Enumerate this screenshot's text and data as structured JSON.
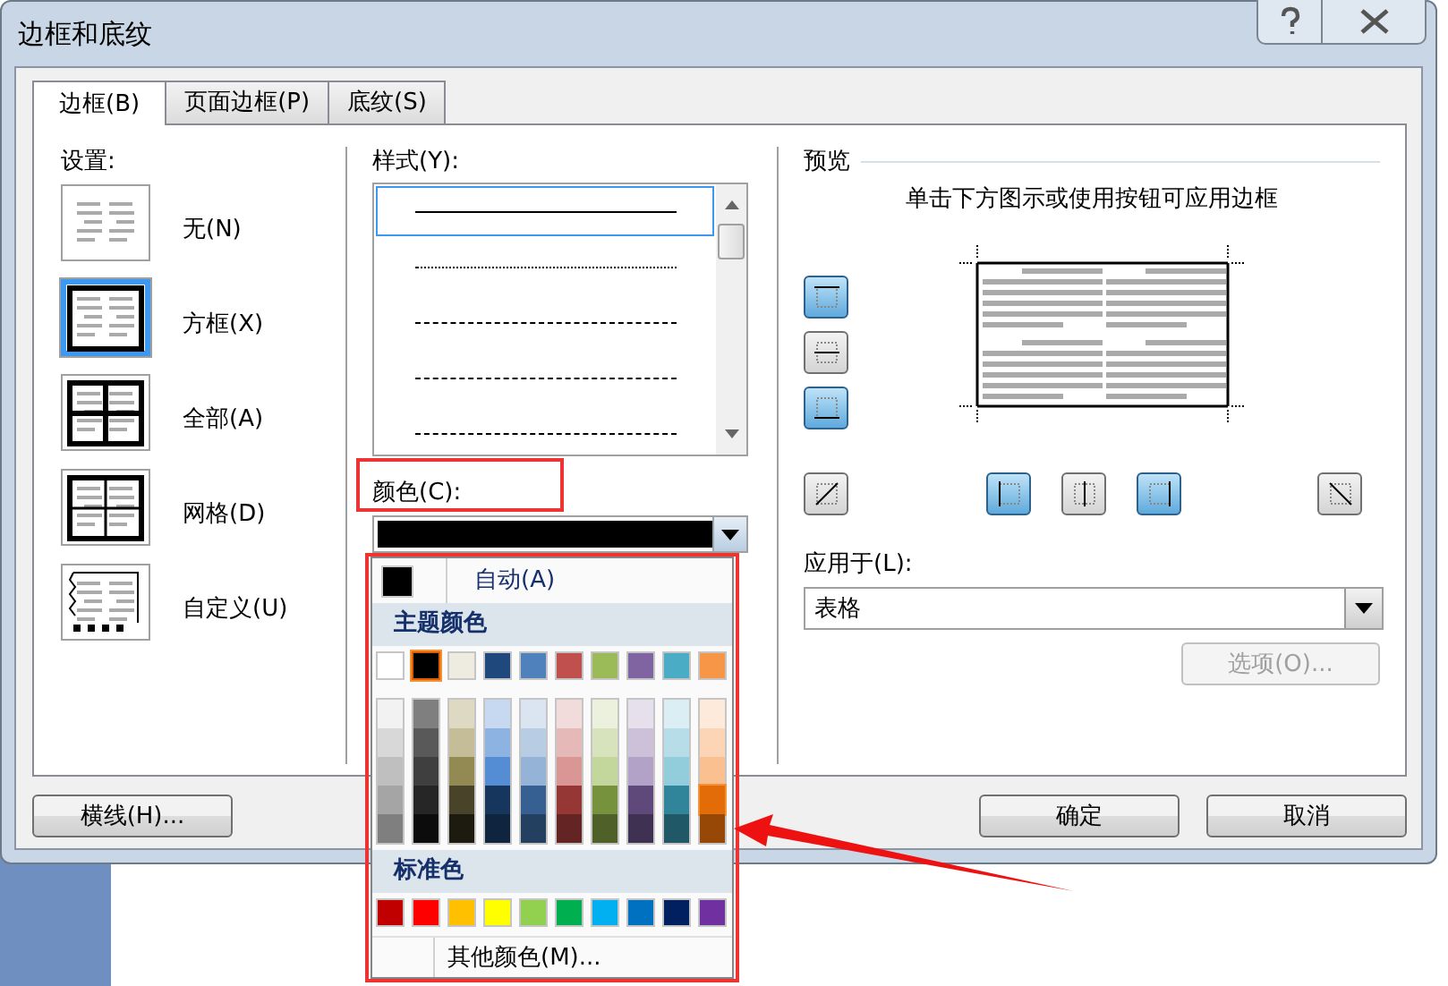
{
  "window": {
    "title": "边框和底纹"
  },
  "tabs": [
    {
      "label": "边框(B)",
      "selected": true
    },
    {
      "label": "页面边框(P)",
      "selected": false
    },
    {
      "label": "底纹(S)",
      "selected": false
    }
  ],
  "settings": {
    "label": "设置:",
    "items": [
      {
        "kind": "none",
        "label": "无(N)",
        "selected": false
      },
      {
        "kind": "box",
        "label": "方框(X)",
        "selected": true
      },
      {
        "kind": "all",
        "label": "全部(A)",
        "selected": false
      },
      {
        "kind": "grid",
        "label": "网格(D)",
        "selected": false
      },
      {
        "kind": "custom",
        "label": "自定义(U)",
        "selected": false
      }
    ]
  },
  "style": {
    "label": "样式(Y):",
    "lines": [
      {
        "kind": "solid",
        "selected": true
      },
      {
        "kind": "dotted",
        "selected": false
      },
      {
        "kind": "dashed",
        "selected": false
      },
      {
        "kind": "long-dash",
        "selected": false
      },
      {
        "kind": "dash-dot",
        "selected": false
      }
    ]
  },
  "color": {
    "label": "颜色(C):",
    "color": "#000000"
  },
  "color_menu": {
    "automatic": {
      "label": "自动(A)",
      "color": "#000000"
    },
    "theme_heading": "主题颜色",
    "theme_colors": [
      {
        "color": "#ffffff",
        "selected": false
      },
      {
        "color": "#000000",
        "selected": true
      },
      {
        "color": "#eeece1",
        "selected": false
      },
      {
        "color": "#1f497d",
        "selected": false
      },
      {
        "color": "#4f81bd",
        "selected": false
      },
      {
        "color": "#c0504d",
        "selected": false
      },
      {
        "color": "#9bbb59",
        "selected": false
      },
      {
        "color": "#8064a2",
        "selected": false
      },
      {
        "color": "#4bacc6",
        "selected": false
      },
      {
        "color": "#f79646",
        "selected": false
      }
    ],
    "theme_shades": [
      [
        {
          "color": "#f2f2f2",
          "selected": false
        },
        {
          "color": "#d8d8d8",
          "selected": false
        },
        {
          "color": "#bfbfbf",
          "selected": false
        },
        {
          "color": "#a5a5a5",
          "selected": false
        },
        {
          "color": "#7f7f7f",
          "selected": false
        }
      ],
      [
        {
          "color": "#7f7f7f",
          "selected": false
        },
        {
          "color": "#595959",
          "selected": false
        },
        {
          "color": "#3f3f3f",
          "selected": false
        },
        {
          "color": "#262626",
          "selected": false
        },
        {
          "color": "#0c0c0c",
          "selected": false
        }
      ],
      [
        {
          "color": "#ddd9c3",
          "selected": false
        },
        {
          "color": "#c4bd97",
          "selected": false
        },
        {
          "color": "#938953",
          "selected": false
        },
        {
          "color": "#494429",
          "selected": false
        },
        {
          "color": "#1d1b10",
          "selected": false
        }
      ],
      [
        {
          "color": "#c6d9f0",
          "selected": false
        },
        {
          "color": "#8db3e2",
          "selected": false
        },
        {
          "color": "#548dd4",
          "selected": false
        },
        {
          "color": "#17365d",
          "selected": false
        },
        {
          "color": "#0f243e",
          "selected": false
        }
      ],
      [
        {
          "color": "#dbe5f1",
          "selected": false
        },
        {
          "color": "#b8cce4",
          "selected": false
        },
        {
          "color": "#95b3d7",
          "selected": false
        },
        {
          "color": "#366092",
          "selected": false
        },
        {
          "color": "#244061",
          "selected": false
        }
      ],
      [
        {
          "color": "#f2dcdb",
          "selected": false
        },
        {
          "color": "#e5b9b7",
          "selected": false
        },
        {
          "color": "#d99694",
          "selected": false
        },
        {
          "color": "#953734",
          "selected": false
        },
        {
          "color": "#632423",
          "selected": false
        }
      ],
      [
        {
          "color": "#ebf1dd",
          "selected": false
        },
        {
          "color": "#d7e3bc",
          "selected": false
        },
        {
          "color": "#c3d69b",
          "selected": false
        },
        {
          "color": "#76923c",
          "selected": false
        },
        {
          "color": "#4f6128",
          "selected": false
        }
      ],
      [
        {
          "color": "#e5e0ec",
          "selected": false
        },
        {
          "color": "#ccc1d9",
          "selected": false
        },
        {
          "color": "#b2a2c7",
          "selected": false
        },
        {
          "color": "#5f497a",
          "selected": false
        },
        {
          "color": "#3f3151",
          "selected": false
        }
      ],
      [
        {
          "color": "#dbeef3",
          "selected": false
        },
        {
          "color": "#b7dde8",
          "selected": false
        },
        {
          "color": "#92cddc",
          "selected": false
        },
        {
          "color": "#31859b",
          "selected": false
        },
        {
          "color": "#205867",
          "selected": false
        }
      ],
      [
        {
          "color": "#fdeada",
          "selected": false
        },
        {
          "color": "#fbd5b5",
          "selected": false
        },
        {
          "color": "#fac08f",
          "selected": false
        },
        {
          "color": "#e36c09",
          "selected": true
        },
        {
          "color": "#974806",
          "selected": false
        }
      ]
    ],
    "standard_heading": "标准色",
    "standard_colors": [
      {
        "color": "#c00000",
        "selected": false
      },
      {
        "color": "#ff0000",
        "selected": false
      },
      {
        "color": "#ffc000",
        "selected": false
      },
      {
        "color": "#ffff00",
        "selected": false
      },
      {
        "color": "#92d050",
        "selected": false
      },
      {
        "color": "#00b050",
        "selected": false
      },
      {
        "color": "#00b0f0",
        "selected": false
      },
      {
        "color": "#0070c0",
        "selected": false
      },
      {
        "color": "#002060",
        "selected": false
      },
      {
        "color": "#7030a0",
        "selected": false
      }
    ],
    "more_colors": "其他颜色(M)..."
  },
  "preview": {
    "label": "预览",
    "hint": "单击下方图示或使用按钮可应用边框",
    "side_buttons": [
      {
        "kind": "top",
        "on": true
      },
      {
        "kind": "middle",
        "on": false
      },
      {
        "kind": "bottom",
        "on": true
      }
    ],
    "bottom_buttons": [
      {
        "kind": "diagonal-up",
        "on": false
      },
      {
        "kind": "left",
        "on": true
      },
      {
        "kind": "center",
        "on": false
      },
      {
        "kind": "right",
        "on": true
      },
      {
        "kind": "diagonal-down",
        "on": false
      }
    ]
  },
  "apply_to": {
    "label": "应用于(L):",
    "value": "表格"
  },
  "options_button": {
    "label": "选项(O)...",
    "disabled": true
  },
  "horizontal_line_button": "横线(H)...",
  "buttons": [
    "确定",
    "取消"
  ]
}
